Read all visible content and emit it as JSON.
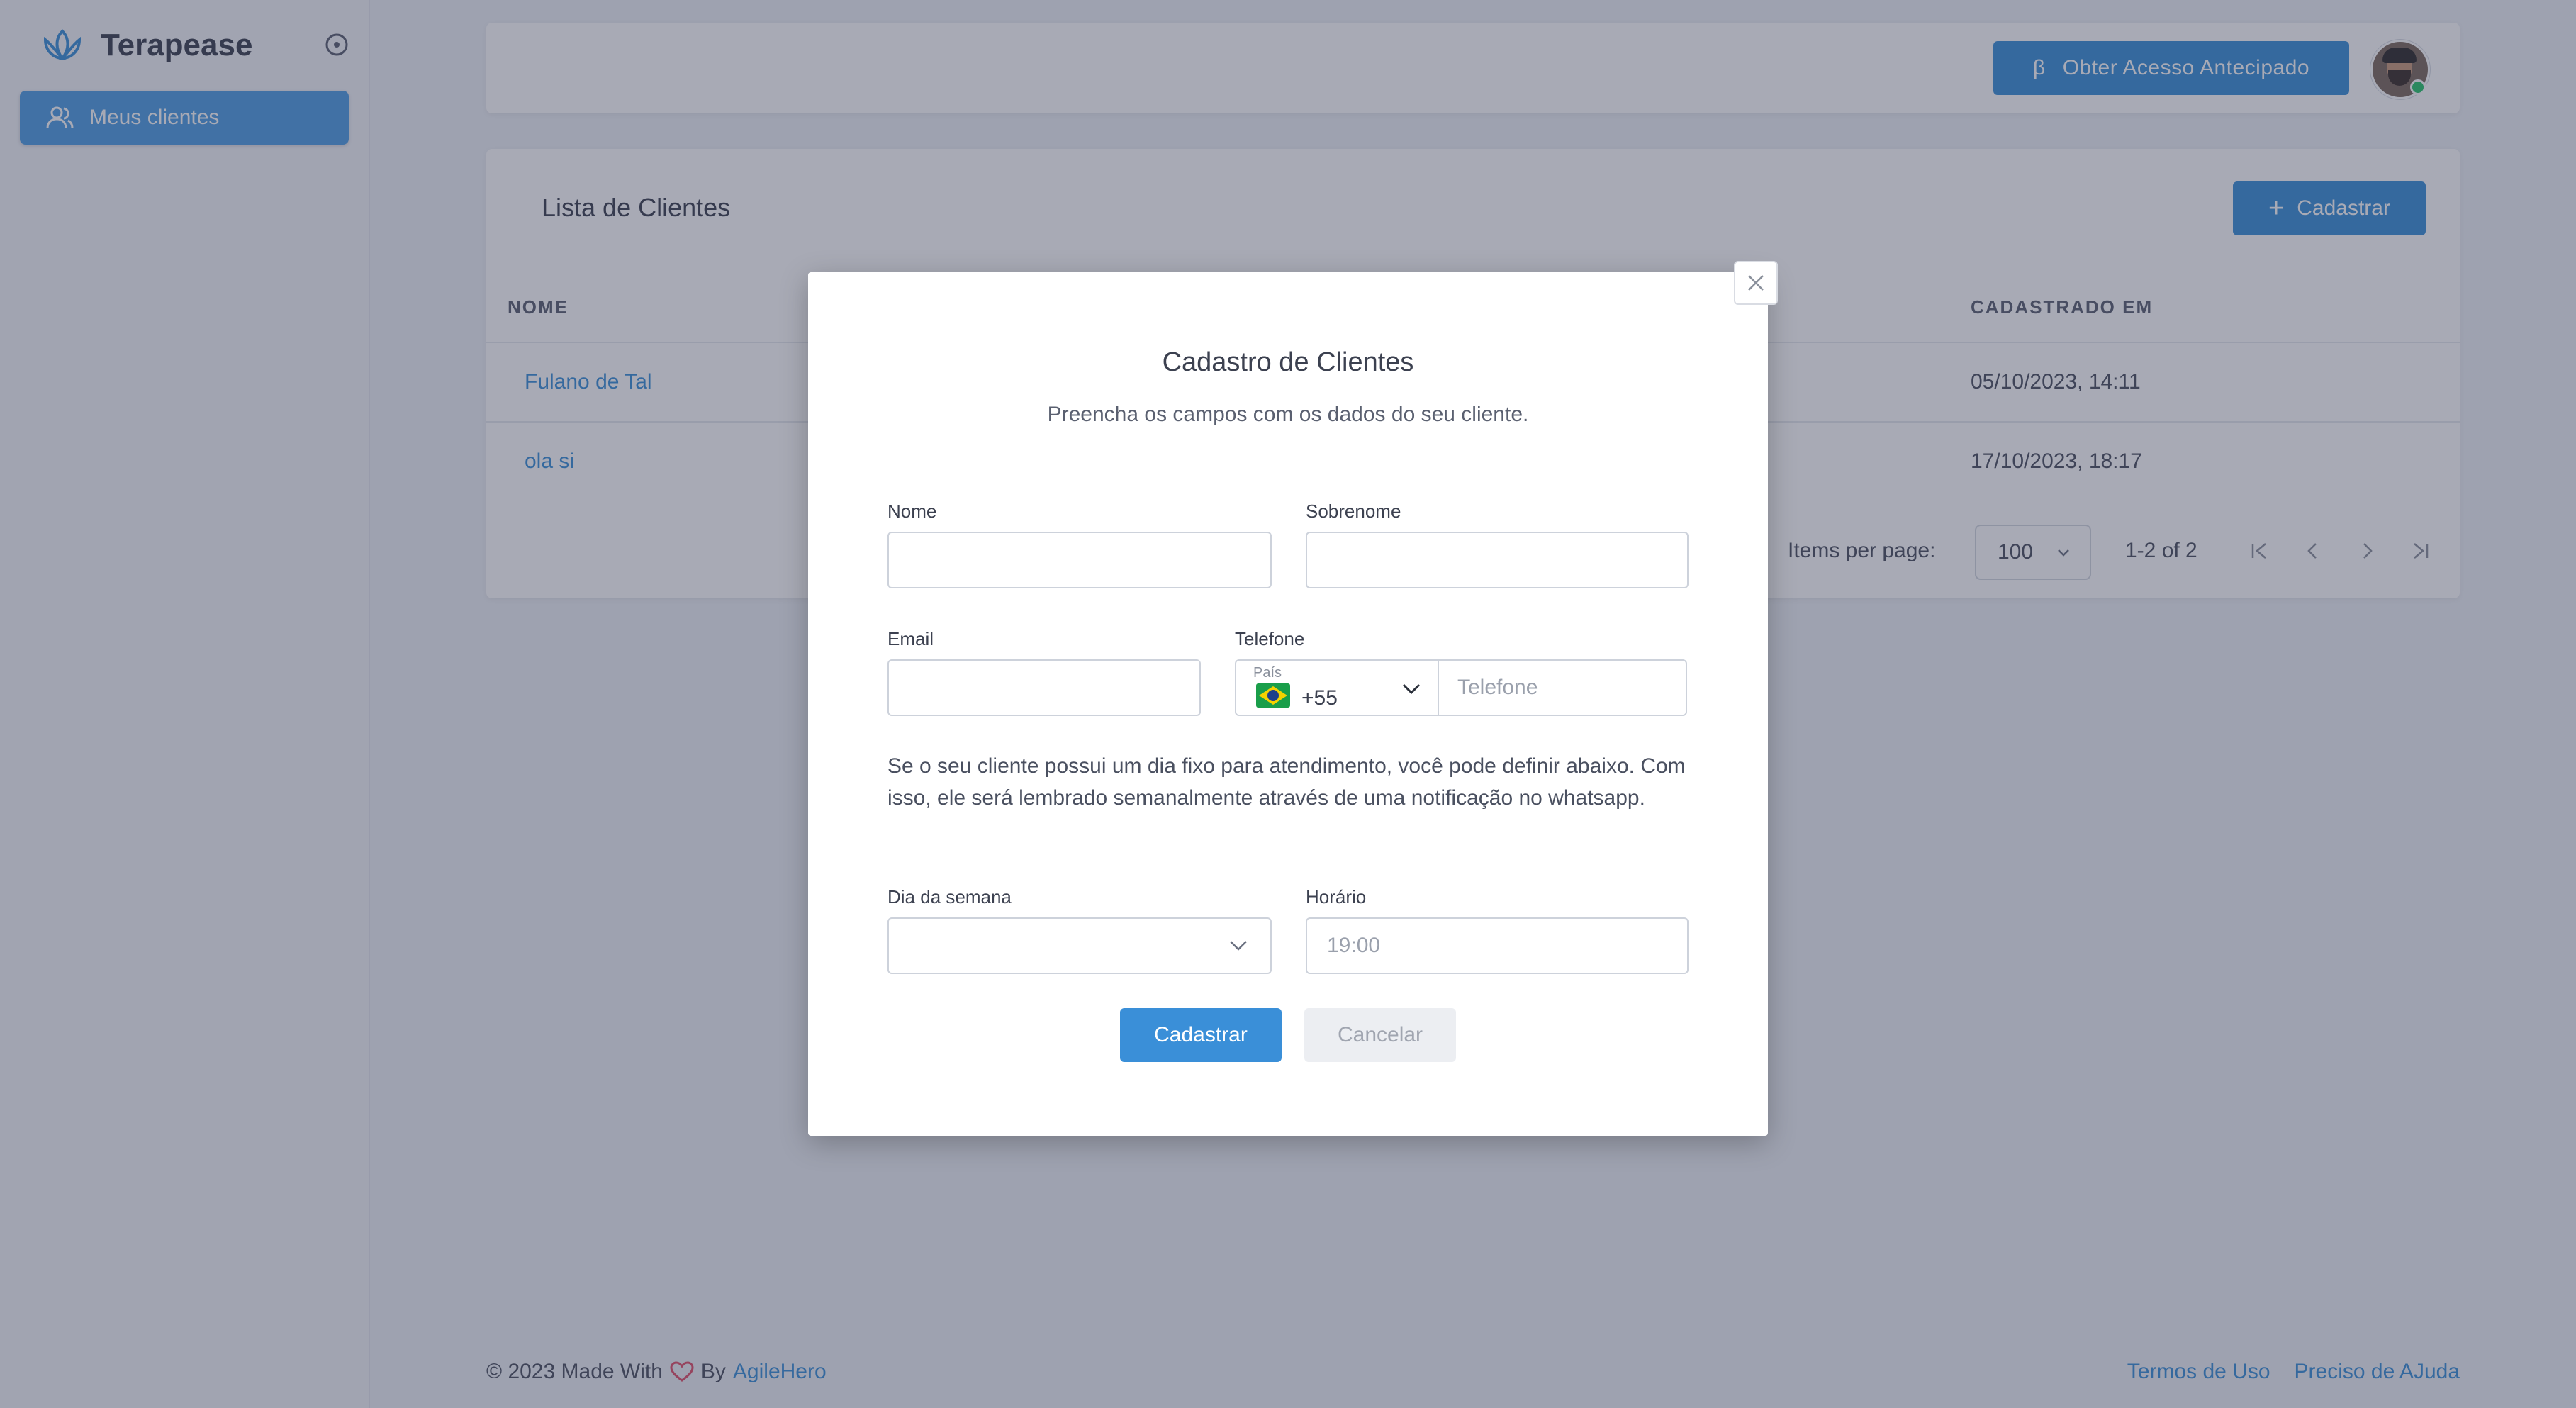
{
  "app": {
    "name": "Terapease"
  },
  "sidebar": {
    "items": [
      {
        "label": "Meus clientes",
        "icon": "users-icon",
        "active": true
      }
    ]
  },
  "header": {
    "beta_symbol": "β",
    "beta_button": "Obter Acesso Antecipado",
    "avatar_icon": "user-avatar"
  },
  "list": {
    "title": "Lista de Clientes",
    "register_button": "Cadastrar",
    "columns": {
      "name": "NOME",
      "created": "CADASTRADO EM"
    },
    "rows": [
      {
        "name": "Fulano de Tal",
        "created": "05/10/2023, 14:11"
      },
      {
        "name": "ola si",
        "created": "17/10/2023, 18:17"
      }
    ],
    "pagination": {
      "items_per_page_label": "Items per page:",
      "items_per_page": "100",
      "range": "1-2 of 2"
    }
  },
  "footer": {
    "copyright": "© 2023 Made With",
    "by": "By",
    "brand": "AgileHero",
    "links": [
      "Termos de Uso",
      "Preciso de AJuda"
    ]
  },
  "modal": {
    "title": "Cadastro de Clientes",
    "subtitle": "Preencha os campos com os dados do seu cliente.",
    "fields": {
      "first_name": {
        "label": "Nome",
        "value": ""
      },
      "last_name": {
        "label": "Sobrenome",
        "value": ""
      },
      "email": {
        "label": "Email",
        "value": ""
      },
      "phone": {
        "label": "Telefone",
        "country_label": "País",
        "dial_code": "+55",
        "placeholder": "Telefone"
      },
      "weekday": {
        "label": "Dia da semana",
        "value": ""
      },
      "time": {
        "label": "Horário",
        "placeholder": "19:00"
      }
    },
    "info": "Se o seu cliente possui um dia fixo para atendimento, você pode definir abaixo. Com isso, ele será lembrado semanalmente através de uma notificação no whatsapp.",
    "submit": "Cadastrar",
    "cancel": "Cancelar"
  },
  "colors": {
    "primary": "#3a8fd8",
    "overlay": "rgba(48,52,78,0.42)",
    "sidebar_active": "#4f9ee3"
  }
}
